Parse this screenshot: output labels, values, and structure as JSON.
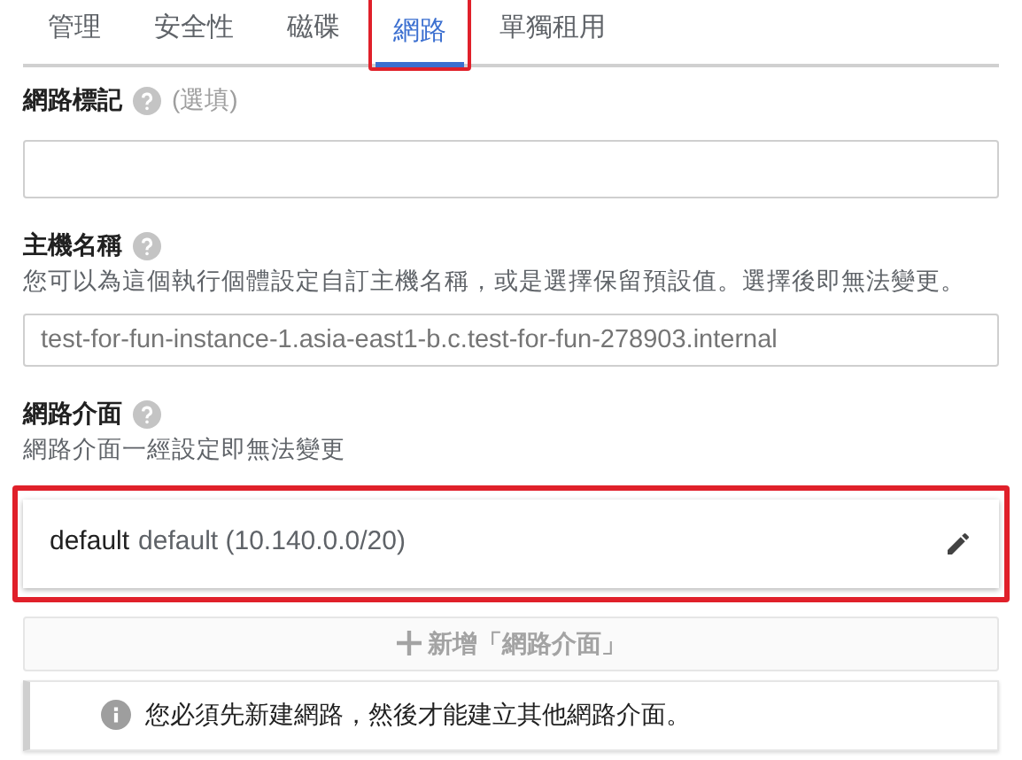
{
  "tabs": [
    {
      "label": "管理",
      "selected": false,
      "highlighted": false
    },
    {
      "label": "安全性",
      "selected": false,
      "highlighted": false
    },
    {
      "label": "磁碟",
      "selected": false,
      "highlighted": false
    },
    {
      "label": "網路",
      "selected": true,
      "highlighted": true
    },
    {
      "label": "單獨租用",
      "selected": false,
      "highlighted": false
    }
  ],
  "network_tags": {
    "label": "網路標記",
    "optional": "(選填)"
  },
  "hostname": {
    "label": "主機名稱",
    "description": "您可以為這個執行個體設定自訂主機名稱，或是選擇保留預設值。選擇後即無法變更。",
    "placeholder": "test-for-fun-instance-1.asia-east1-b.c.test-for-fun-278903.internal"
  },
  "network_interfaces": {
    "label": "網路介面",
    "description": "網路介面一經設定即無法變更",
    "items": [
      {
        "name": "default",
        "detail": "default (10.140.0.0/20)",
        "highlighted": true
      }
    ],
    "add_button": {
      "label": "新增「網路介面」",
      "disabled": true
    },
    "notice": "您必須先新建網路，然後才能建立其他網路介面。"
  }
}
